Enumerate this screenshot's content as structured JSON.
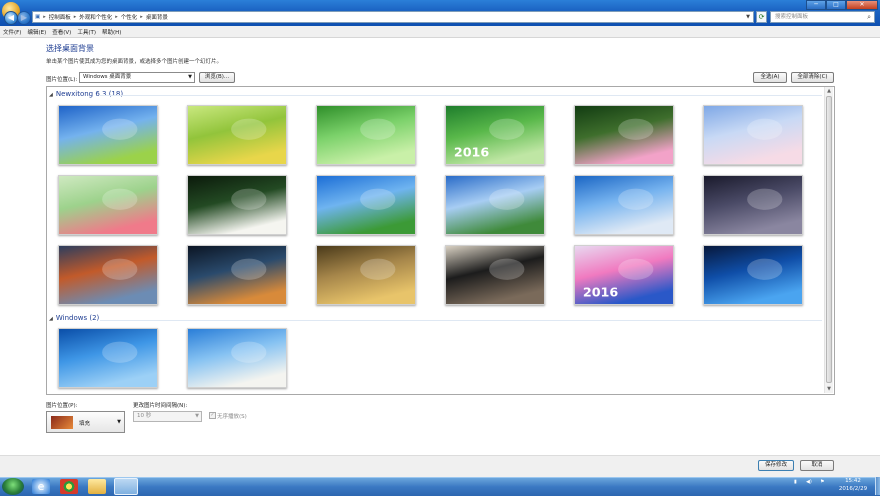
{
  "address": {
    "crumbs": [
      "控制面板",
      "外观和个性化",
      "个性化",
      "桌面背景"
    ],
    "search_placeholder": "搜索控制面板"
  },
  "window_buttons": {
    "minimize": "─",
    "maximize": "□",
    "close": "✕"
  },
  "menubar": [
    "文件(F)",
    "编辑(E)",
    "查看(V)",
    "工具(T)",
    "帮助(H)"
  ],
  "page": {
    "title": "选择桌面背景",
    "subtitle": "单击某个图片使其成为您的桌面背景，或选择多个图片创建一个幻灯片。"
  },
  "location": {
    "label": "图片位置(L):",
    "value": "Windows 桌面背景",
    "browse": "浏览(B)...",
    "select_all": "全选(A)",
    "clear_all": "全部清除(C)"
  },
  "groups": [
    {
      "title": "Newxitong 6.3 (18)",
      "thumbs": [
        {
          "name": "blue-sky-clouds",
          "colors": [
            "#1f63c8",
            "#74b2ee",
            "#9bd24a"
          ]
        },
        {
          "name": "yellow-flowers",
          "colors": [
            "#c9e87f",
            "#92c43b",
            "#e8d64a"
          ]
        },
        {
          "name": "green-leaves",
          "colors": [
            "#2f8f2a",
            "#7bd16a",
            "#c9f0a8"
          ]
        },
        {
          "name": "green-2016",
          "colors": [
            "#1e7d2c",
            "#59b84a",
            "#bfe6a4"
          ],
          "text": "2016"
        },
        {
          "name": "pink-flowers",
          "colors": [
            "#123c12",
            "#3e6e2c",
            "#f2a2c8"
          ]
        },
        {
          "name": "cherry-blossom",
          "colors": [
            "#7fa8e6",
            "#c8d9f5",
            "#f6dbe6"
          ]
        },
        {
          "name": "pink-lily",
          "colors": [
            "#cfe9c1",
            "#9dd28c",
            "#f07a8a"
          ]
        },
        {
          "name": "lily-of-valley",
          "colors": [
            "#0b1a0b",
            "#234a23",
            "#f5f5f0"
          ]
        },
        {
          "name": "sky-meadow",
          "colors": [
            "#1c6ed6",
            "#6fb4f0",
            "#3c9a36"
          ]
        },
        {
          "name": "wind-turbine-road",
          "colors": [
            "#2a6cc8",
            "#a7cdf3",
            "#3f8a3a"
          ]
        },
        {
          "name": "eiffel-tower",
          "colors": [
            "#1b66c4",
            "#76b3ef",
            "#dfe9f5"
          ]
        },
        {
          "name": "night-mountains",
          "colors": [
            "#1a1a2c",
            "#4a4a66",
            "#8a86a0"
          ]
        },
        {
          "name": "el-capitan",
          "colors": [
            "#2c3d5e",
            "#c25a2a",
            "#6c8cb4"
          ]
        },
        {
          "name": "planet-space",
          "colors": [
            "#0b1524",
            "#2a4a6c",
            "#d88a3a"
          ]
        },
        {
          "name": "girl-field",
          "colors": [
            "#4a3a1a",
            "#a6864a",
            "#e8c46a"
          ]
        },
        {
          "name": "girl-headphones",
          "colors": [
            "#d8d0c2",
            "#1c1c1c",
            "#7a6a5a"
          ]
        },
        {
          "name": "runners",
          "colors": [
            "#e8d8f0",
            "#f07ac0",
            "#2a58c8"
          ],
          "text": "2016"
        },
        {
          "name": "windows-10",
          "colors": [
            "#07183c",
            "#0f4ea8",
            "#4aa4f0"
          ]
        }
      ]
    },
    {
      "title": "Windows (2)",
      "thumbs": [
        {
          "name": "windows-7",
          "colors": [
            "#0a4ea8",
            "#3e96e6",
            "#9cd0f6"
          ]
        },
        {
          "name": "white-daisies",
          "colors": [
            "#2a7ed8",
            "#86c2f2",
            "#f4f4f0"
          ]
        }
      ]
    }
  ],
  "position": {
    "label": "图片位置(P):",
    "value": "填充"
  },
  "interval": {
    "label": "更改图片时间间隔(N):",
    "value": "10 秒"
  },
  "shuffle": {
    "label": "无序播放(S)"
  },
  "footer": {
    "save": "保存修改",
    "cancel": "取消"
  },
  "clock": {
    "time": "15:42",
    "date": "2016/2/29"
  }
}
